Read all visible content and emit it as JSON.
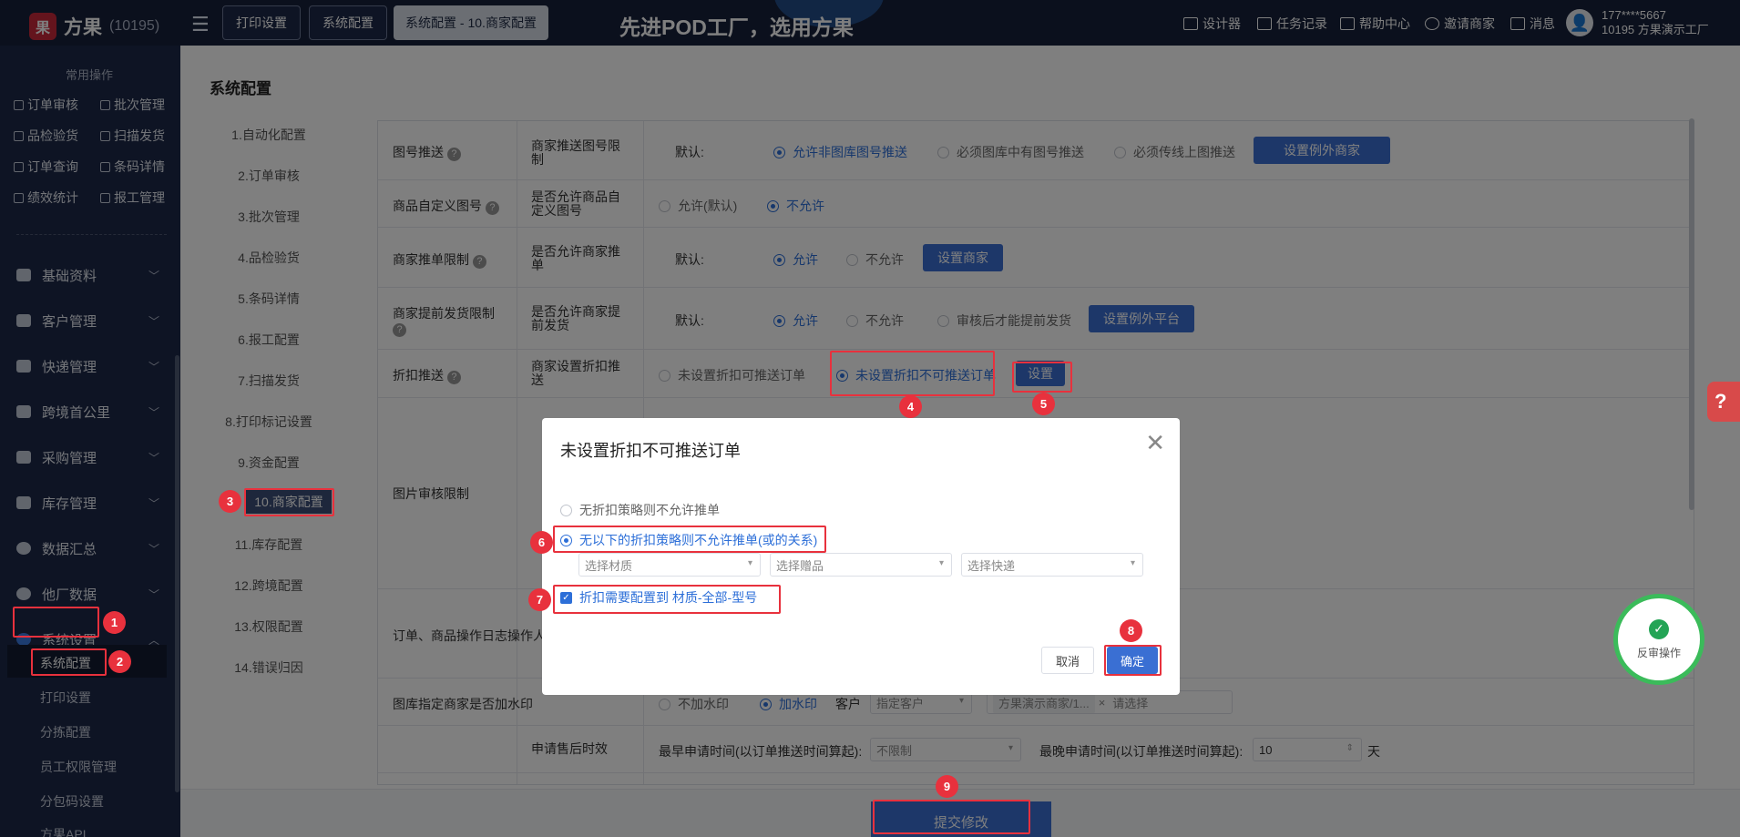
{
  "app": {
    "name": "方果",
    "count": "(10195)"
  },
  "topbar": {
    "tabs": [
      "打印设置",
      "系统配置",
      "系统配置 - 10.商家配置"
    ],
    "slogan": "先进POD工厂，选用方果",
    "links": [
      "设计器",
      "任务记录",
      "帮助中心",
      "邀请商家",
      "消息"
    ],
    "user_phone": "177****5667",
    "user_factory": "10195  方果演示工厂"
  },
  "sidebar": {
    "quick_title": "常用操作",
    "quick": [
      "订单审核",
      "批次管理",
      "品检验货",
      "扫描发货",
      "订单查询",
      "条码详情",
      "绩效统计",
      "报工管理"
    ],
    "groups": [
      "基础资料",
      "客户管理",
      "快递管理",
      "跨境首公里",
      "采购管理",
      "库存管理",
      "数据汇总",
      "他厂数据",
      "系统设置"
    ],
    "subs": [
      "系统配置",
      "打印设置",
      "分拣配置",
      "员工权限管理",
      "分包码设置",
      "方果API"
    ]
  },
  "main": {
    "title": "系统配置",
    "nav": [
      "1.自动化配置",
      "2.订单审核",
      "3.批次管理",
      "4.品检验货",
      "5.条码详情",
      "6.报工配置",
      "7.扫描发货",
      "8.打印标记设置",
      "9.资金配置",
      "10.商家配置",
      "11.库存配置",
      "12.跨境配置",
      "13.权限配置",
      "14.错误归因"
    ],
    "rows": {
      "r1": {
        "name": "图号推送",
        "desc": "商家推送图号限制",
        "label": "默认:",
        "opts": [
          "允许非图库图号推送",
          "必须图库中有图号推送",
          "必须传线上图推送"
        ],
        "btn": "设置例外商家"
      },
      "r2": {
        "name": "商品自定义图号",
        "desc": "是否允许商品自定义图号",
        "opts": [
          "允许(默认)",
          "不允许"
        ]
      },
      "r3": {
        "name": "商家推单限制",
        "desc": "是否允许商家推单",
        "label": "默认:",
        "opts": [
          "允许",
          "不允许"
        ],
        "btn": "设置商家"
      },
      "r4": {
        "name": "商家提前发货限制",
        "desc": "是否允许商家提前发货",
        "label": "默认:",
        "opts": [
          "允许",
          "不允许",
          "审核后才能提前发货"
        ],
        "btn": "设置例外平台"
      },
      "r5": {
        "name": "折扣推送",
        "desc": "商家设置折扣推送",
        "opts": [
          "未设置折扣可推送订单",
          "未设置折扣不可推送订单"
        ],
        "btn": "设置"
      },
      "r6": {
        "name": "图片审核限制"
      },
      "r7": {
        "name": "订单、商品操作日志操作人"
      },
      "r8": {
        "name": "图库指定商家是否加水印",
        "opts": [
          "不加水印",
          "加水印"
        ],
        "customer_label": "客户",
        "customer_select": "指定客户",
        "merchant_tag": "方果演示商家/1...",
        "pick": "请选择"
      },
      "r9": {
        "desc": "申请售后时效",
        "earliest_label": "最早申请时间(以订单推送时间算起):",
        "earliest_value": "不限制",
        "latest_label": "最晚申请时间(以订单推送时间算起):",
        "latest_value": "10",
        "unit": "天"
      }
    },
    "submit": "提交修改"
  },
  "dialog": {
    "title": "未设置折扣不可推送订单",
    "opt1": "无折扣策略则不允许推单",
    "opt2": "无以下的折扣策略则不允许推单(或的关系)",
    "sel_material": "选择材质",
    "sel_gift": "选择赠品",
    "sel_express": "选择快递",
    "check": "折扣需要配置到 材质-全部-型号",
    "cancel": "取消",
    "ok": "确定"
  },
  "float": {
    "review": "反审操作",
    "help": "?"
  },
  "badges": [
    "1",
    "2",
    "3",
    "4",
    "5",
    "6",
    "7",
    "8",
    "9"
  ]
}
